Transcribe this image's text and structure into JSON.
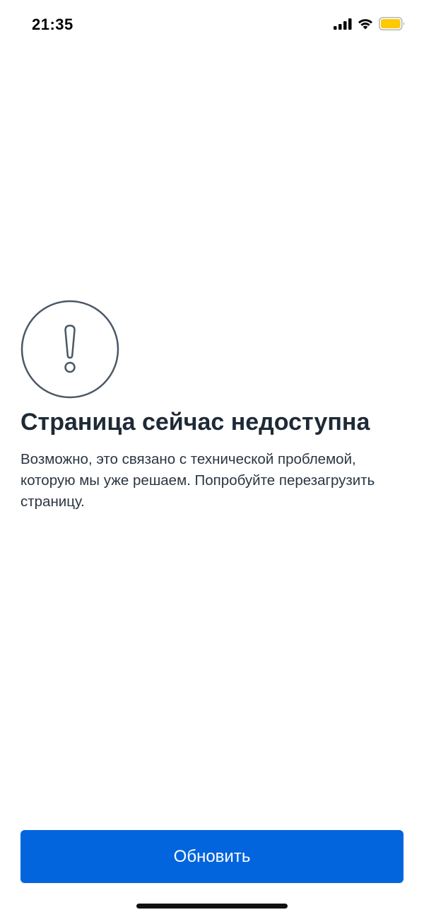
{
  "status_bar": {
    "time": "21:35",
    "icons": [
      "cellular-signal-icon",
      "wifi-icon",
      "battery-icon"
    ],
    "battery_color": "#ffc800"
  },
  "error": {
    "icon": "exclamation-circle-icon",
    "title": "Страница сейчас недоступна",
    "description": "Возможно, это связано с технической проблемой, которую мы уже решаем. Попробуйте перезагрузить страницу."
  },
  "actions": {
    "refresh_label": "Обновить",
    "accent_color": "#0365dd"
  }
}
